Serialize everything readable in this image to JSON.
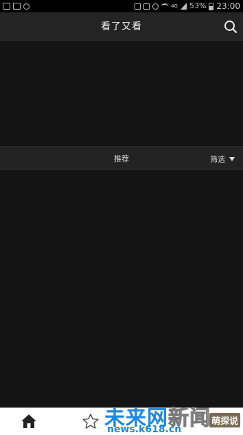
{
  "status_bar": {
    "network_type": "4G",
    "battery_percent": "53%",
    "time": "23:00",
    "icons": [
      "notification-icon",
      "vpn-icon",
      "cloud-icon",
      "nfc-icon",
      "mute-icon",
      "alarm-icon",
      "wifi-icon",
      "signal-icon",
      "battery-icon"
    ]
  },
  "header": {
    "title": "看了又看",
    "search_icon": "search-icon"
  },
  "filter_bar": {
    "recommend_label": "推荐",
    "filter_label": "筛选",
    "filter_icon": "caret-down-icon"
  },
  "bottom_nav": {
    "items": [
      {
        "icon": "home-icon",
        "selected": true
      },
      {
        "icon": "star-icon",
        "selected": false
      }
    ]
  },
  "watermark": {
    "line1_main": "未来网",
    "line1_tail": "新闻",
    "line2": "news.k618.cn",
    "badge": "萌探说"
  },
  "colors": {
    "background": "#141414",
    "header_bg": "#242424",
    "filter_bar_bg": "#232323",
    "bottom_nav_bg": "#ffffff",
    "watermark_blue": "#1b88e0"
  }
}
